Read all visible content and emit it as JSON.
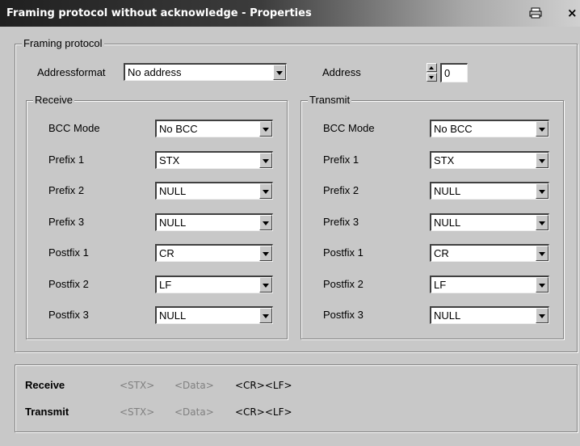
{
  "window": {
    "title": "Framing protocol without acknowledge - Properties",
    "icons": [
      "print-icon",
      "close-icon"
    ],
    "close_glyph": "×"
  },
  "framing_protocol": {
    "group_title": "Framing protocol",
    "addressformat_label": "Addressformat",
    "addressformat_value": "No address",
    "address_label": "Address",
    "address_value": "0"
  },
  "receive": {
    "group_title": "Receive",
    "rows": [
      {
        "label": "BCC Mode",
        "value": "No BCC"
      },
      {
        "label": "Prefix 1",
        "value": "STX"
      },
      {
        "label": "Prefix 2",
        "value": "NULL"
      },
      {
        "label": "Prefix 3",
        "value": "NULL"
      },
      {
        "label": "Postfix 1",
        "value": "CR"
      },
      {
        "label": "Postfix 2",
        "value": "LF"
      },
      {
        "label": "Postfix 3",
        "value": "NULL"
      }
    ]
  },
  "transmit": {
    "group_title": "Transmit",
    "rows": [
      {
        "label": "BCC Mode",
        "value": "No BCC"
      },
      {
        "label": "Prefix 1",
        "value": "STX"
      },
      {
        "label": "Prefix 2",
        "value": "NULL"
      },
      {
        "label": "Prefix 3",
        "value": "NULL"
      },
      {
        "label": "Postfix 1",
        "value": "CR"
      },
      {
        "label": "Postfix 2",
        "value": "LF"
      },
      {
        "label": "Postfix 3",
        "value": "NULL"
      }
    ]
  },
  "summary": {
    "receive": {
      "label": "Receive",
      "prefix": "<STX>",
      "data": "<Data>",
      "postfix": "<CR><LF>"
    },
    "transmit": {
      "label": "Transmit",
      "prefix": "<STX>",
      "data": "<Data>",
      "postfix": "<CR><LF>"
    }
  }
}
